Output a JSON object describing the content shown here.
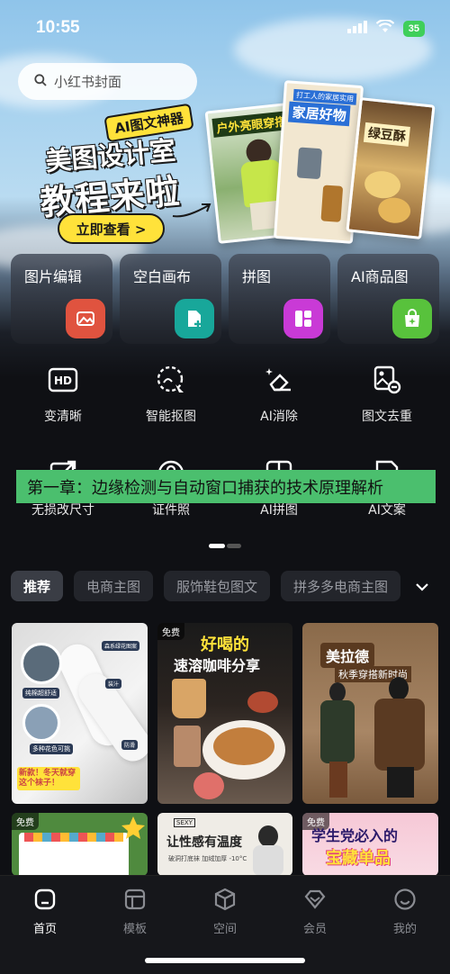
{
  "status_bar": {
    "time": "10:55",
    "battery": "35"
  },
  "search": {
    "placeholder": "小红书封面"
  },
  "banner": {
    "tag": "AI图文神器",
    "title_line1": "美图设计室",
    "title_line2": "教程来啦",
    "cta": "立即查看 >",
    "posters": [
      {
        "title": "户外亮眼穿搭"
      },
      {
        "subtitle": "打工人的家居实用",
        "title": "家居好物"
      },
      {
        "title": "绿豆酥"
      }
    ]
  },
  "feature_cards": [
    {
      "label": "图片编辑",
      "icon": "image-edit-icon",
      "color": "#e0533f"
    },
    {
      "label": "空白画布",
      "icon": "canvas-plus-icon",
      "color": "#18a79a"
    },
    {
      "label": "拼图",
      "icon": "collage-icon",
      "color": "#c93ad6"
    },
    {
      "label": "AI商品图",
      "icon": "shopping-bag-icon",
      "color": "#58c23c"
    }
  ],
  "tools_row1": [
    {
      "label": "变清晰",
      "icon": "hd-icon"
    },
    {
      "label": "智能抠图",
      "icon": "smart-cutout-icon"
    },
    {
      "label": "AI消除",
      "icon": "eraser-icon"
    },
    {
      "label": "图文去重",
      "icon": "image-dedup-icon"
    }
  ],
  "tools_row2": [
    {
      "label": "无损改尺寸",
      "icon": "resize-icon"
    },
    {
      "label": "证件照",
      "icon": "id-photo-icon"
    },
    {
      "label": "AI拼图",
      "icon": "ai-collage-icon"
    },
    {
      "label": "AI文案",
      "icon": "ai-copywriting-icon"
    }
  ],
  "overlay_caption": "第一章：边缘检测与自动窗口捕获的技术原理解析",
  "category_tabs": [
    "推荐",
    "电商主图",
    "服饰鞋包图文",
    "拼多多电商主图"
  ],
  "templates": {
    "free_badge": "免费",
    "tile1": {
      "labels": [
        "纯棉超舒适",
        "多种花色可挑",
        "森系绿花图案",
        "装汁",
        "防滑"
      ],
      "caption": "新款！冬天就穿这个袜子！"
    },
    "tile2": {
      "title": "好喝的",
      "subtitle": "速溶咖啡分享"
    },
    "tile3": {
      "title": "美拉德",
      "subtitle": "秋季穿搭新时尚"
    },
    "tile5": {
      "title": "让性感有温度",
      "subtitle": "破洞打底袜 加绒加厚 -10°C",
      "brand": "SEXY"
    },
    "tile6": {
      "title": "学生党必入的",
      "subtitle": "宝藏单品"
    }
  },
  "bottom_nav": [
    {
      "label": "首页",
      "icon": "home-icon",
      "active": true
    },
    {
      "label": "模板",
      "icon": "template-icon",
      "active": false
    },
    {
      "label": "空间",
      "icon": "cube-icon",
      "active": false
    },
    {
      "label": "会员",
      "icon": "diamond-icon",
      "active": false
    },
    {
      "label": "我的",
      "icon": "profile-icon",
      "active": false
    }
  ],
  "colors": {
    "accent_yellow": "#ffe23a",
    "caption_green": "#4bbf6e",
    "background": "#0f1014"
  }
}
